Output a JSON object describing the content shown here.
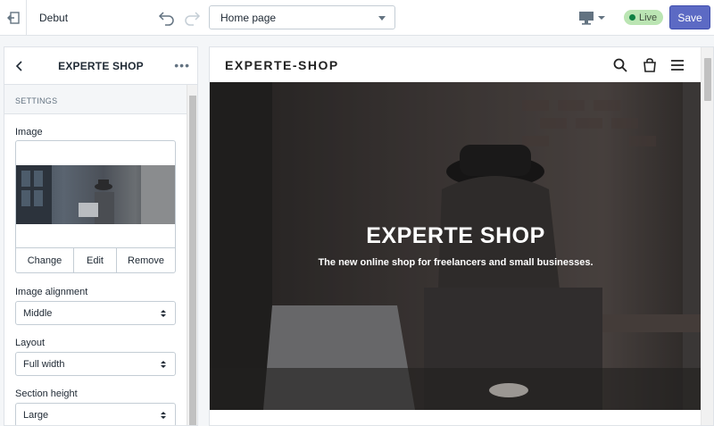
{
  "topbar": {
    "theme_name": "Debut",
    "page_select": "Home page",
    "live_label": "Live",
    "save_label": "Save",
    "icons": [
      "exit-icon",
      "undo-icon",
      "redo-icon",
      "desktop-icon",
      "chevron-down-icon"
    ]
  },
  "sidebar": {
    "title": "EXPERTE SHOP",
    "more_label": "•••",
    "section_header": "SETTINGS",
    "image_label": "Image",
    "image_actions": {
      "change": "Change",
      "edit": "Edit",
      "remove": "Remove"
    },
    "alignment_label": "Image alignment",
    "alignment_value": "Middle",
    "layout_label": "Layout",
    "layout_value": "Full width",
    "height_label": "Section height",
    "height_value": "Large"
  },
  "preview": {
    "logo": "EXPERTE-SHOP",
    "hero_title": "EXPERTE SHOP",
    "hero_subtitle": "The new online shop for freelancers and small businesses.",
    "icons": [
      "search-icon",
      "cart-icon",
      "menu-icon"
    ]
  },
  "colors": {
    "accent": "#5c6ac4",
    "live_badge": "#bbe5b3",
    "live_dot": "#108043"
  }
}
